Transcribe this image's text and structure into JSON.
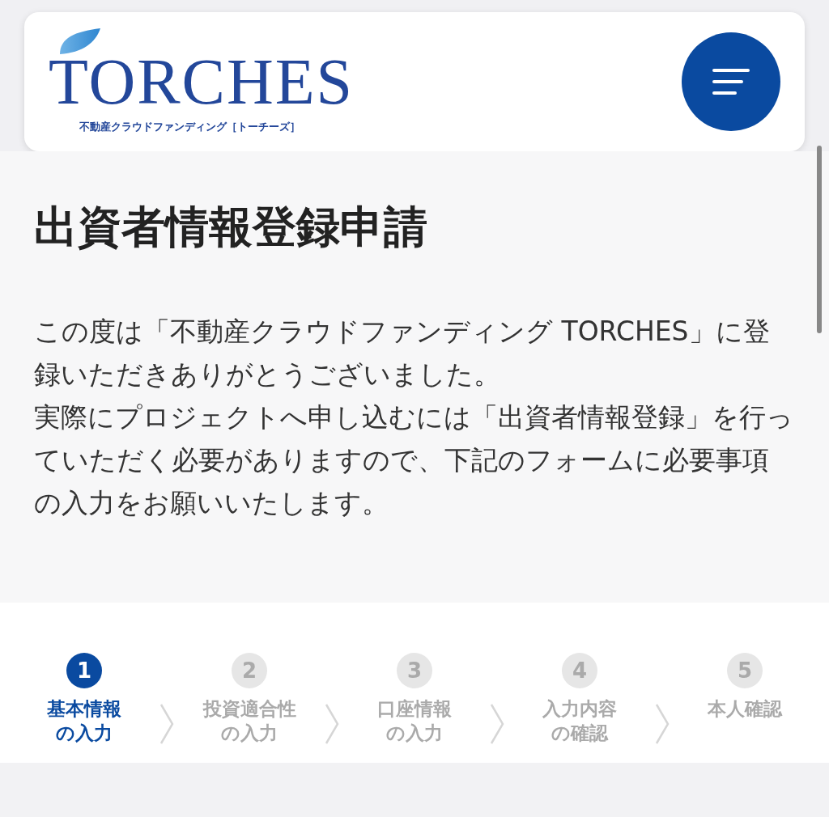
{
  "header": {
    "logo_text": "TORCHES",
    "logo_subtitle": "不動産クラウドファンディング［トーチーズ］"
  },
  "page": {
    "title": "出資者情報登録申請",
    "paragraphs": [
      "この度は「不動産クラウドファンディング TORCHES」に登録いただきありがとうございました。",
      "実際にプロジェクトへ申し込むには「出資者情報登録」を行っていただく必要がありますので、下記のフォームに必要事項の入力をお願いいたします。"
    ]
  },
  "steps": [
    {
      "number": "1",
      "label_lines": [
        "基本情報",
        "の入力"
      ],
      "selected": true
    },
    {
      "number": "2",
      "label_lines": [
        "投資適合性",
        "の入力"
      ],
      "selected": false
    },
    {
      "number": "3",
      "label_lines": [
        "口座情報",
        "の入力"
      ],
      "selected": false
    },
    {
      "number": "4",
      "label_lines": [
        "入力内容",
        "の確認"
      ],
      "selected": false
    },
    {
      "number": "5",
      "label_lines": [
        "本人確認"
      ],
      "selected": false
    }
  ]
}
